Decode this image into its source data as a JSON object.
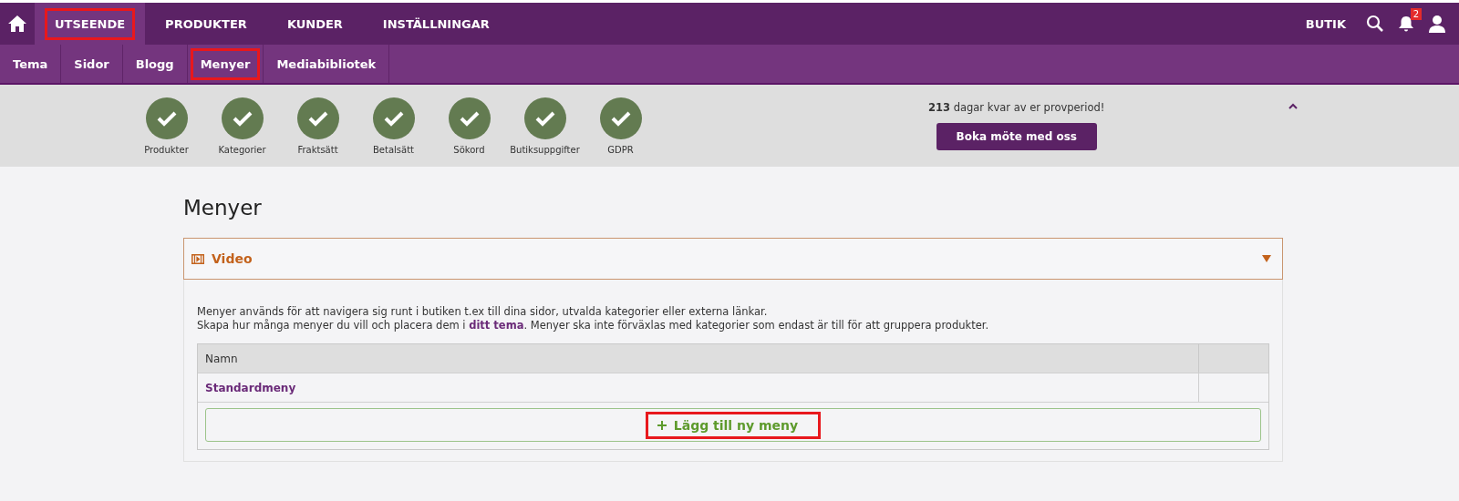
{
  "top_nav": {
    "items": [
      {
        "label": "UTSEENDE",
        "selected": true,
        "highlighted": true
      },
      {
        "label": "PRODUKTER",
        "selected": false,
        "highlighted": false
      },
      {
        "label": "KUNDER",
        "selected": false,
        "highlighted": false
      },
      {
        "label": "INSTÄLLNINGAR",
        "selected": false,
        "highlighted": false
      }
    ],
    "shop_link": "BUTIK",
    "notification_count": "2"
  },
  "sub_nav": {
    "items": [
      {
        "label": "Tema",
        "highlighted": false
      },
      {
        "label": "Sidor",
        "highlighted": false
      },
      {
        "label": "Blogg",
        "highlighted": false
      },
      {
        "label": "Menyer",
        "highlighted": true
      },
      {
        "label": "Mediabibliotek",
        "highlighted": false
      }
    ]
  },
  "setup_steps": [
    {
      "label": "Produkter",
      "done": true
    },
    {
      "label": "Kategorier",
      "done": true
    },
    {
      "label": "Fraktsätt",
      "done": true
    },
    {
      "label": "Betalsätt",
      "done": true
    },
    {
      "label": "Sökord",
      "done": true
    },
    {
      "label": "Butiksuppgifter",
      "done": true
    },
    {
      "label": "GDPR",
      "done": true
    }
  ],
  "trial": {
    "message": "**213** dagar kvar av er provperiod!",
    "button": "Boka möte med oss"
  },
  "page_title": "Menyer",
  "video_panel": {
    "title": "Video"
  },
  "description": {
    "line_1": "Menyer används för att navigera sig runt i butiken t.ex till dina sidor, utvalda kategorier eller externa länkar.",
    "line_2_before": "Skapa hur många menyer du vill och placera dem i ",
    "line_2_link": "ditt tema",
    "line_2_after": ". Menyer ska inte förväxlas med kategorier som endast är till för att gruppera produkter."
  },
  "table": {
    "columns": [
      "Namn"
    ],
    "rows": [
      {
        "name": "Standardmeny"
      }
    ]
  },
  "add_button": {
    "label": "Lägg till ny meny",
    "highlighted": true
  }
}
